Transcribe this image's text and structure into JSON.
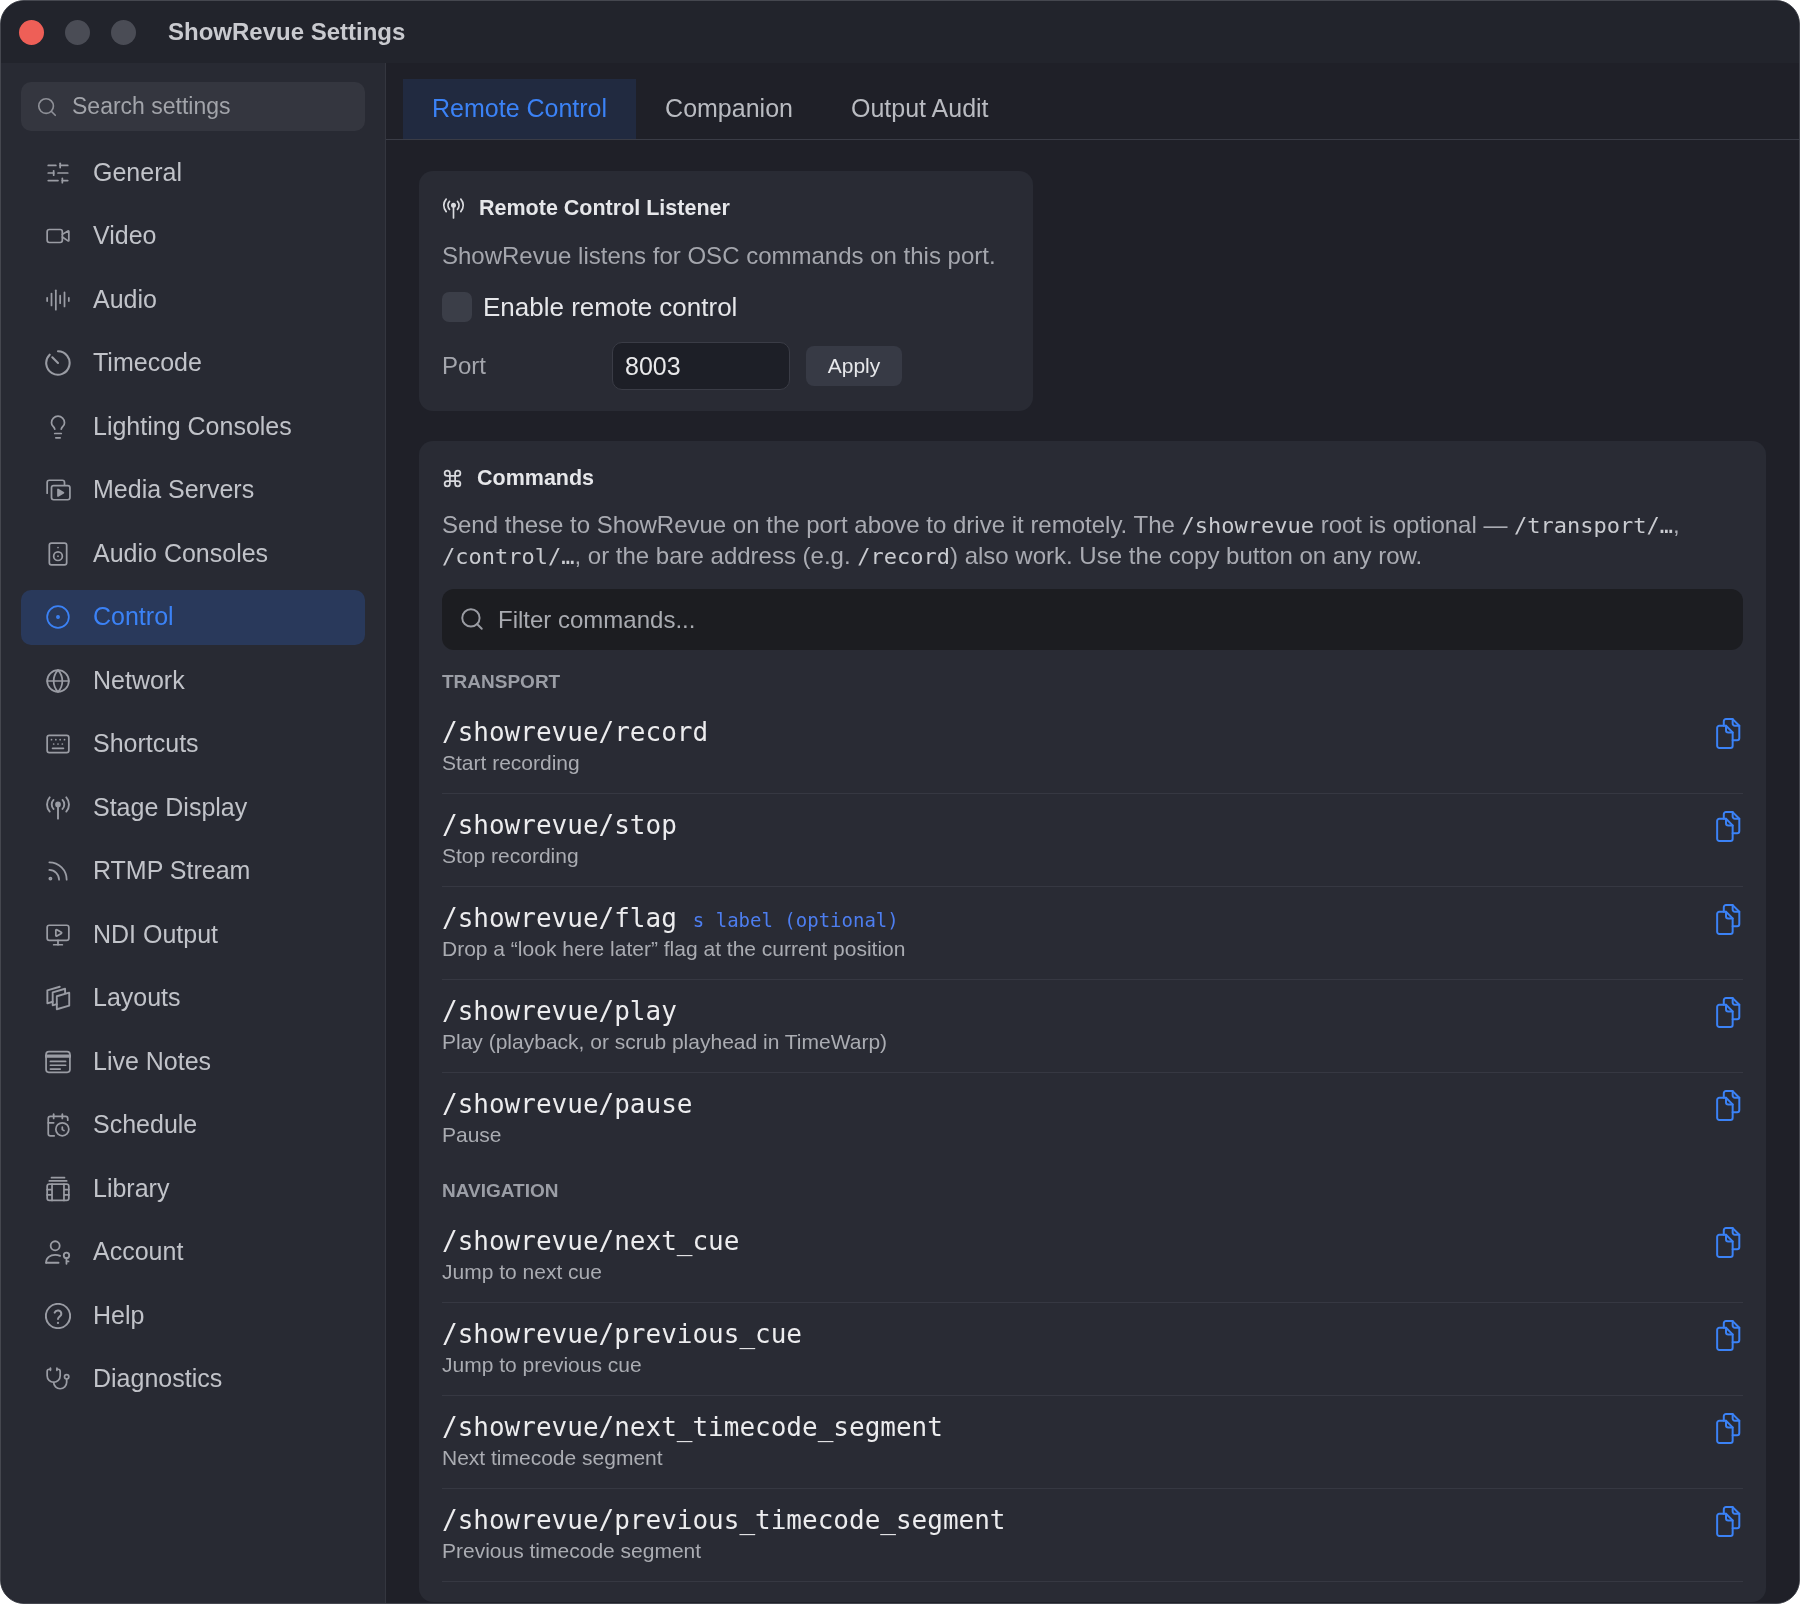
{
  "window": {
    "title": "ShowRevue Settings"
  },
  "sidebar": {
    "search": {
      "placeholder": "Search settings"
    },
    "items": [
      {
        "label": "General",
        "selected": false
      },
      {
        "label": "Video",
        "selected": false
      },
      {
        "label": "Audio",
        "selected": false
      },
      {
        "label": "Timecode",
        "selected": false
      },
      {
        "label": "Lighting Consoles",
        "selected": false
      },
      {
        "label": "Media Servers",
        "selected": false
      },
      {
        "label": "Audio Consoles",
        "selected": false
      },
      {
        "label": "Control",
        "selected": true
      },
      {
        "label": "Network",
        "selected": false
      },
      {
        "label": "Shortcuts",
        "selected": false
      },
      {
        "label": "Stage Display",
        "selected": false
      },
      {
        "label": "RTMP Stream",
        "selected": false
      },
      {
        "label": "NDI Output",
        "selected": false
      },
      {
        "label": "Layouts",
        "selected": false
      },
      {
        "label": "Live Notes",
        "selected": false
      },
      {
        "label": "Schedule",
        "selected": false
      },
      {
        "label": "Library",
        "selected": false
      },
      {
        "label": "Account",
        "selected": false
      },
      {
        "label": "Help",
        "selected": false
      },
      {
        "label": "Diagnostics",
        "selected": false
      }
    ]
  },
  "tabs": [
    {
      "label": "Remote Control",
      "selected": true
    },
    {
      "label": "Companion",
      "selected": false
    },
    {
      "label": "Output Audit",
      "selected": false
    }
  ],
  "listener": {
    "title": "Remote Control Listener",
    "description": "ShowRevue listens for OSC commands on this port.",
    "enable": {
      "label": "Enable remote control",
      "checked": false
    },
    "port": {
      "label": "Port",
      "value": "8003"
    },
    "apply_button": "Apply"
  },
  "commands": {
    "title": "Commands",
    "description": [
      {
        "kind": "text",
        "text": "Send these to ShowRevue on the port above to drive it remotely. The "
      },
      {
        "kind": "code",
        "text": "/showrevue"
      },
      {
        "kind": "text",
        "text": " root is optional — "
      },
      {
        "kind": "code",
        "text": "/transport/…"
      },
      {
        "kind": "text",
        "text": ", "
      },
      {
        "kind": "code",
        "text": "/control/…"
      },
      {
        "kind": "text",
        "text": ", or the bare address (e.g. "
      },
      {
        "kind": "code",
        "text": "/record"
      },
      {
        "kind": "text",
        "text": ") also work. Use the copy button on any row."
      }
    ],
    "filter": {
      "placeholder": "Filter commands..."
    },
    "sections": [
      {
        "title": "TRANSPORT",
        "rows": [
          {
            "command": "/showrevue/record",
            "description": "Start recording"
          },
          {
            "command": "/showrevue/stop",
            "description": "Stop recording"
          },
          {
            "command": "/showrevue/flag",
            "args": "s label (optional)",
            "description": "Drop a “look here later” flag at the current position"
          },
          {
            "command": "/showrevue/play",
            "description": "Play (playback, or scrub playhead in TimeWarp)"
          },
          {
            "command": "/showrevue/pause",
            "description": "Pause"
          }
        ]
      },
      {
        "title": "NAVIGATION",
        "rows": [
          {
            "command": "/showrevue/next_cue",
            "description": "Jump to next cue"
          },
          {
            "command": "/showrevue/previous_cue",
            "description": "Jump to previous cue"
          },
          {
            "command": "/showrevue/next_timecode_segment",
            "description": "Next timecode segment"
          },
          {
            "command": "/showrevue/previous_timecode_segment",
            "description": "Previous timecode segment"
          }
        ]
      }
    ]
  }
}
